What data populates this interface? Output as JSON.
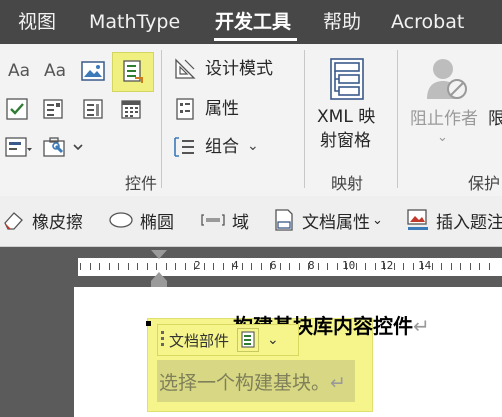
{
  "tabs": [
    {
      "label": "视图",
      "active": false
    },
    {
      "label": "MathType",
      "active": false
    },
    {
      "label": "开发工具",
      "active": true
    },
    {
      "label": "帮助",
      "active": false
    },
    {
      "label": "Acrobat",
      "active": false
    }
  ],
  "ribbon": {
    "controls_group": {
      "label": "控件",
      "aa_text": "Aa",
      "design_mode": "设计模式",
      "properties": "属性",
      "group": "组合"
    },
    "mapping_group": {
      "label": "映射",
      "xml_line1": "XML 映",
      "xml_line2": "射窗格"
    },
    "protect_group": {
      "label": "保护",
      "block_authors": "阻止作者",
      "restrict": "限"
    }
  },
  "quick_toolbar": {
    "eraser": "橡皮擦",
    "ellipse": "椭圆",
    "field": "域",
    "doc_properties": "文档属性",
    "insert_caption": "插入题注"
  },
  "ruler": {
    "numbers": [
      "2",
      "4",
      "6",
      "8",
      "10",
      "12",
      "14"
    ]
  },
  "document": {
    "heading": "构建基块库内容控件",
    "pilcrow": "↵",
    "content_control": {
      "tag_label": "文档部件",
      "placeholder": "选择一个构建基块。"
    }
  },
  "colors": {
    "tab_bar": "#474747",
    "highlight": "#f5f58c",
    "selected_button": "#f0f080"
  }
}
